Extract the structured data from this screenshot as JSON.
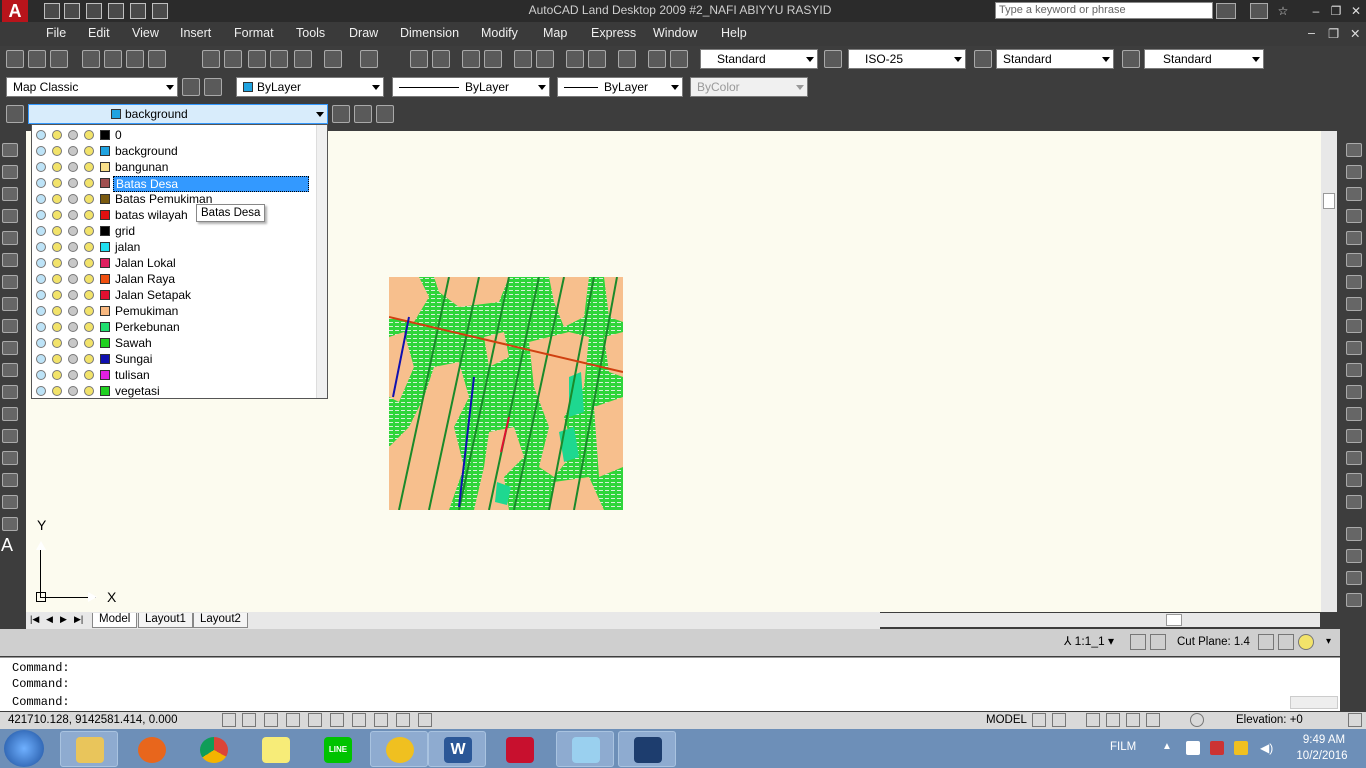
{
  "window": {
    "title": "AutoCAD Land Desktop 2009 #2_NAFI ABIYYU RASYID",
    "search_placeholder": "Type a keyword or phrase",
    "controls": {
      "minimize": "–",
      "restore": "❐",
      "close": "✕"
    }
  },
  "menu": {
    "items": [
      "File",
      "Edit",
      "View",
      "Insert",
      "Format",
      "Tools",
      "Draw",
      "Dimension",
      "Modify",
      "Map",
      "Express",
      "Window",
      "Help"
    ]
  },
  "styles_toolbar": {
    "text_style": "Standard",
    "dim_style": "ISO-25",
    "table_style": "Standard",
    "multileader_style": "Standard"
  },
  "properties_toolbar": {
    "workspace": "Map Classic",
    "color": "ByLayer",
    "linetype": "ByLayer",
    "lineweight": "ByLayer",
    "plotstyle": "ByColor"
  },
  "layer_toolbar": {
    "current_layer": "background",
    "current_color": "#1fa3e0"
  },
  "layers": [
    {
      "name": "0",
      "color": "#000000"
    },
    {
      "name": "background",
      "color": "#1fa3e0"
    },
    {
      "name": "bangunan",
      "color": "#f8e08a"
    },
    {
      "name": "Batas Desa",
      "color": "#a05050",
      "selected": true
    },
    {
      "name": "Batas Pemukiman",
      "color": "#7a5a10"
    },
    {
      "name": "batas wilayah",
      "color": "#e01010"
    },
    {
      "name": "grid",
      "color": "#000000"
    },
    {
      "name": "jalan",
      "color": "#20e0f0"
    },
    {
      "name": "Jalan Lokal",
      "color": "#e02060"
    },
    {
      "name": "Jalan Raya",
      "color": "#f05010"
    },
    {
      "name": "Jalan Setapak",
      "color": "#e01030"
    },
    {
      "name": "Pemukiman",
      "color": "#f8b880"
    },
    {
      "name": "Perkebunan",
      "color": "#20e070"
    },
    {
      "name": "Sawah",
      "color": "#20d020"
    },
    {
      "name": "Sungai",
      "color": "#1010b0"
    },
    {
      "name": "tulisan",
      "color": "#e020e0"
    },
    {
      "name": "vegetasi",
      "color": "#20d020"
    }
  ],
  "tooltip": "Batas Desa",
  "ucs": {
    "x_label": "X",
    "y_label": "Y"
  },
  "tabs": [
    "Model",
    "Layout1",
    "Layout2"
  ],
  "annotation_bar": {
    "scale": "1:1_1",
    "cut_plane": "Cut Plane: 1.4"
  },
  "command_lines": [
    "Command:",
    "Command:",
    "Command:"
  ],
  "status": {
    "coordinates": "421710.128, 9142581.414, 0.000",
    "model": "MODEL",
    "elevation": "Elevation: +0"
  },
  "taskbar": {
    "apps": [
      "explorer",
      "firefox",
      "chrome",
      "sticky-notes",
      "line",
      "autocad-app",
      "word",
      "acrobat",
      "app-blue",
      "land-desktop"
    ],
    "tray_label": "FILM",
    "time": "9:49 AM",
    "date": "10/2/2016"
  }
}
